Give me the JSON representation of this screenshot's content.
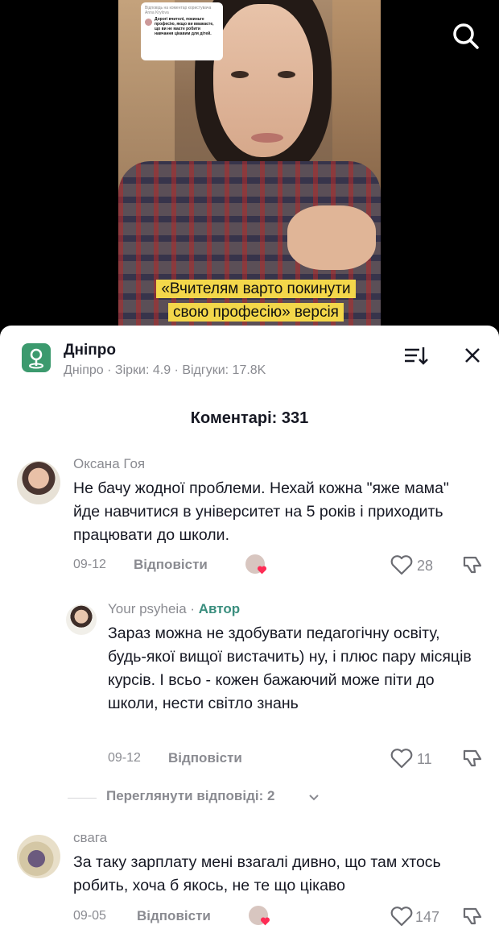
{
  "video": {
    "reply_bubble_header": "Відповідь на коментар користувача Anna Krylova",
    "reply_bubble_text": "Дорогі вчителі, покиньте професію, якщо ви вважаєте, що ви не маєте робити навчання цікавим для дітей.",
    "caption": "«Вчителям варто покинути свою професію» версія"
  },
  "place": {
    "title": "Дніпро",
    "subtitle": "Дніпро · Зірки: 4.9 · Відгуки: 17.8K"
  },
  "comments_title": "Коментарі: 331",
  "reply_label": "Відповісти",
  "comments": [
    {
      "author": "Оксана Гоя",
      "text": "Не бачу жодної проблеми. Нехай кожна \"яже мама\" йде навчитися в університет на 5 років і приходить працювати до школи.",
      "date": "09-12",
      "likes": "28"
    },
    {
      "author": "Your psyheia",
      "author_sep": " · ",
      "author_badge": "Автор",
      "text": "Зараз можна не здобувати педагогічну освіту, будь-якої вищої вистачить) ну, і плюс пару місяців курсів. І всьо - кожен бажаючий може піти до школи, нести світло знань",
      "date": "09-12",
      "likes": "11"
    },
    {
      "author": "свага",
      "text": "За таку зарплату мені взагалі дивно, що там хтось робить, хоча б якось, не те що цікаво",
      "date": "09-05",
      "likes": "147"
    }
  ],
  "view_replies": "Переглянути відповіді: 2",
  "colors": {
    "author_badge": "#3a8e7e",
    "heart": "#fe2c55",
    "caption_highlight": "#f3d74a"
  }
}
